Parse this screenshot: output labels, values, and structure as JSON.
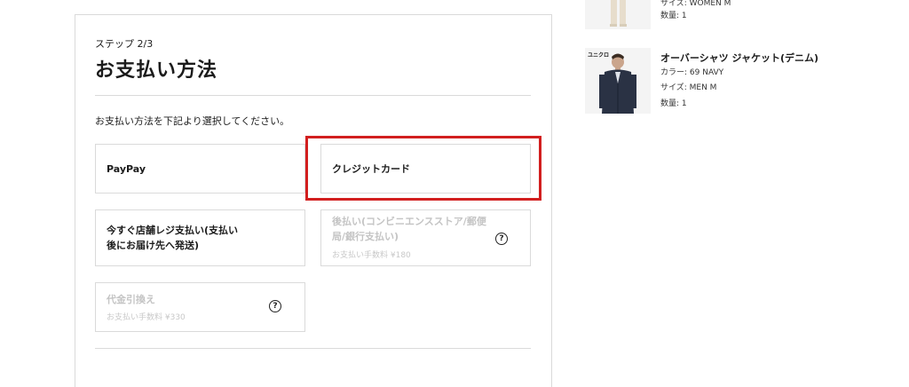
{
  "checkout": {
    "step": "ステップ 2/3",
    "title": "お支払い方法",
    "instruction": "お支払い方法を下記より選択してください。",
    "options": [
      {
        "label": "PayPay",
        "enabled": true
      },
      {
        "label": "クレジットカード",
        "enabled": true,
        "highlighted": true
      },
      {
        "label_line1": "今すぐ店舗レジ支払い(支払い",
        "label_line2": "後にお届け先へ発送)",
        "enabled": true
      },
      {
        "label_line1": "後払い(コンビニエンスストア/郵便",
        "label_line2": "局/銀行支払い)",
        "fee": "お支払い手数料 ¥180",
        "enabled": false,
        "help_icon": "question-circle-icon"
      },
      {
        "label": "代金引換え",
        "fee": "お支払い手数料 ¥330",
        "enabled": false,
        "help_icon": "question-circle-icon"
      }
    ]
  },
  "cart": {
    "items": [
      {
        "partial_text": "サイズ: WOMEN M",
        "quantity": "数量: 1"
      },
      {
        "brand_tag": "ユニクロ",
        "name": "オーバーシャツ ジャケット(デニム)",
        "color": "カラー: 69 NAVY",
        "size": "サイズ: MEN M",
        "quantity": "数量: 1"
      }
    ]
  },
  "colors": {
    "highlight": "#d21f1f",
    "border": "#dadada",
    "disabled_text": "#c4c4c4"
  }
}
